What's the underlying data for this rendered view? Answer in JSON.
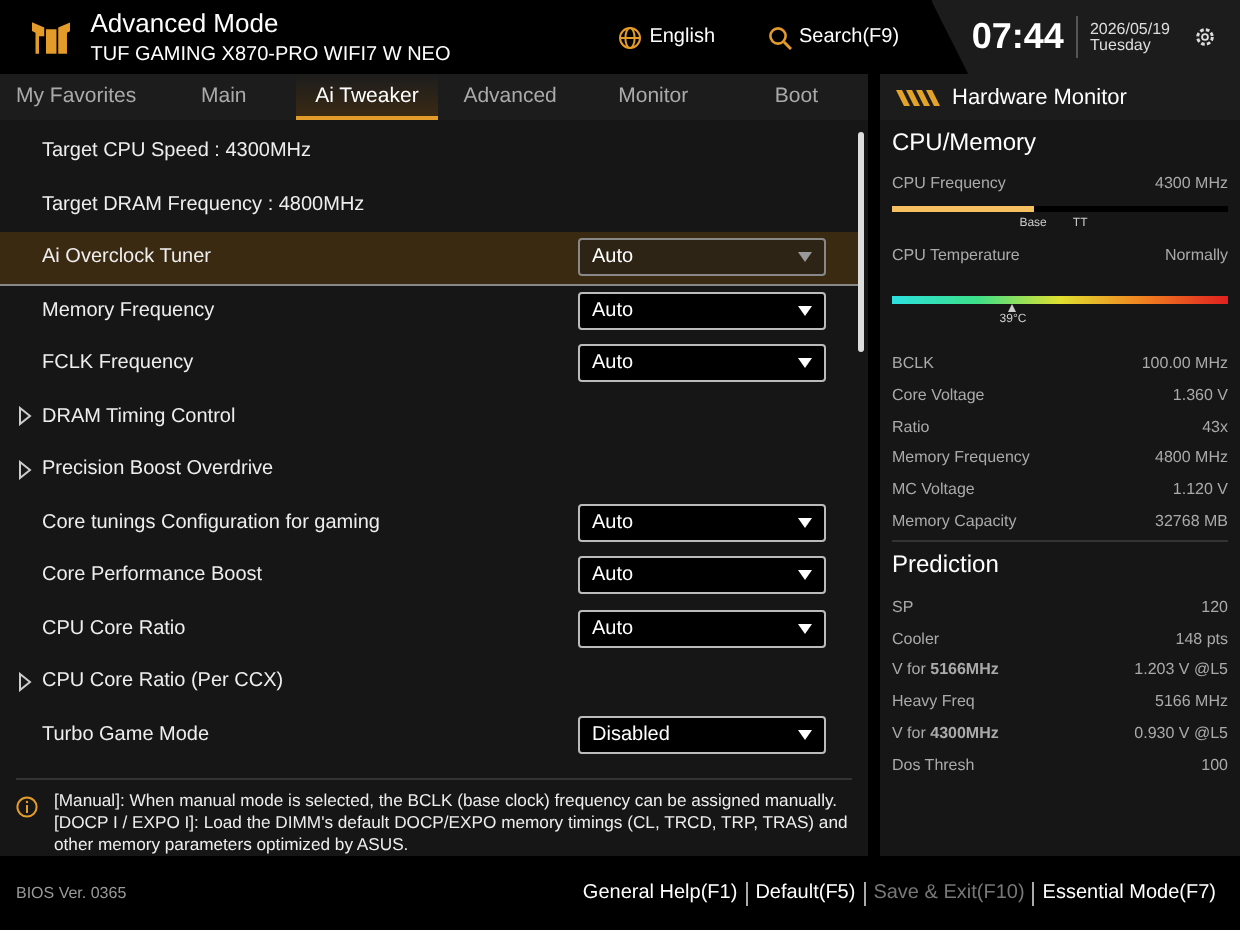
{
  "header": {
    "title": "Advanced Mode",
    "model": "TUF GAMING X870-PRO WIFI7 W NEO",
    "language": "English",
    "search": "Search(F9)",
    "time": "07:44",
    "date": "2026/05/19",
    "weekday": "Tuesday"
  },
  "tabs": [
    {
      "label": "My Favorites",
      "selected": false
    },
    {
      "label": "Main",
      "selected": false
    },
    {
      "label": "Ai Tweaker",
      "selected": true
    },
    {
      "label": "Advanced",
      "selected": false
    },
    {
      "label": "Monitor",
      "selected": false
    },
    {
      "label": "Boot",
      "selected": false
    }
  ],
  "settings": [
    {
      "kind": "info",
      "label": "Target CPU Speed : 4300MHz",
      "selected": false
    },
    {
      "kind": "info",
      "label": "Target DRAM Frequency : 4800MHz",
      "selected": false
    },
    {
      "kind": "select",
      "label": "Ai Overclock Tuner",
      "value": "Auto",
      "selected": true
    },
    {
      "kind": "select",
      "label": "Memory Frequency",
      "value": "Auto",
      "selected": false
    },
    {
      "kind": "select",
      "label": "FCLK Frequency",
      "value": "Auto",
      "selected": false
    },
    {
      "kind": "submenu",
      "label": "DRAM Timing Control",
      "selected": false
    },
    {
      "kind": "submenu",
      "label": "Precision Boost Overdrive",
      "selected": false
    },
    {
      "kind": "select",
      "label": "Core tunings Configuration for gaming",
      "value": "Auto",
      "selected": false
    },
    {
      "kind": "select",
      "label": "Core Performance Boost",
      "value": "Auto",
      "selected": false
    },
    {
      "kind": "select",
      "label": "CPU Core Ratio",
      "value": "Auto",
      "selected": false
    },
    {
      "kind": "submenu",
      "label": "CPU Core Ratio (Per CCX)",
      "selected": false
    },
    {
      "kind": "select",
      "label": "Turbo Game Mode",
      "value": "Disabled",
      "selected": false
    }
  ],
  "help": {
    "lines": [
      "[Manual]: When manual mode is selected, the BCLK (base clock) frequency can be assigned manually.",
      "[DOCP I / EXPO I]: Load the DIMM's default DOCP/EXPO memory timings (CL, TRCD, TRP, TRAS) and",
      "other memory parameters optimized by ASUS."
    ]
  },
  "hardware_monitor": {
    "title": "Hardware Monitor",
    "cpu_memory": {
      "title": "CPU/Memory",
      "cpu_frequency": {
        "label": "CPU Frequency",
        "value": "4300 MHz",
        "level": 0.42,
        "markers": [
          "Base",
          "TT"
        ]
      },
      "cpu_temperature": {
        "label": "CPU Temperature",
        "value": "Normally",
        "level": 0.36,
        "reading": "39°C"
      },
      "stats": [
        {
          "label": "BCLK",
          "value": "100.00 MHz"
        },
        {
          "label": "Core Voltage",
          "value": "1.360 V"
        },
        {
          "label": "Ratio",
          "value": "43x"
        },
        {
          "label": "Memory Frequency",
          "value": "4800 MHz"
        },
        {
          "label": "MC Voltage",
          "value": "1.120 V"
        },
        {
          "label": "Memory Capacity",
          "value": "32768 MB"
        }
      ]
    },
    "prediction": {
      "title": "Prediction",
      "stats": [
        {
          "label": "SP",
          "value": "120"
        },
        {
          "label": "Cooler",
          "value": "148 pts"
        },
        {
          "label": "V for **5166MHz**",
          "value": "1.203 V @L5"
        },
        {
          "label": "Heavy Freq",
          "value": "5166 MHz"
        },
        {
          "label": "V for **4300MHz**",
          "value": "0.930 V @L5"
        },
        {
          "label": "Dos Thresh",
          "value": "100"
        }
      ]
    }
  },
  "footer": {
    "version": "BIOS Ver. 0365",
    "actions": [
      {
        "label": "General Help(F1)",
        "disabled": false
      },
      {
        "label": "Default(F5)",
        "disabled": false
      },
      {
        "label": "Save & Exit(F10)",
        "disabled": true
      },
      {
        "label": "Essential Mode(F7)",
        "disabled": false
      }
    ]
  }
}
